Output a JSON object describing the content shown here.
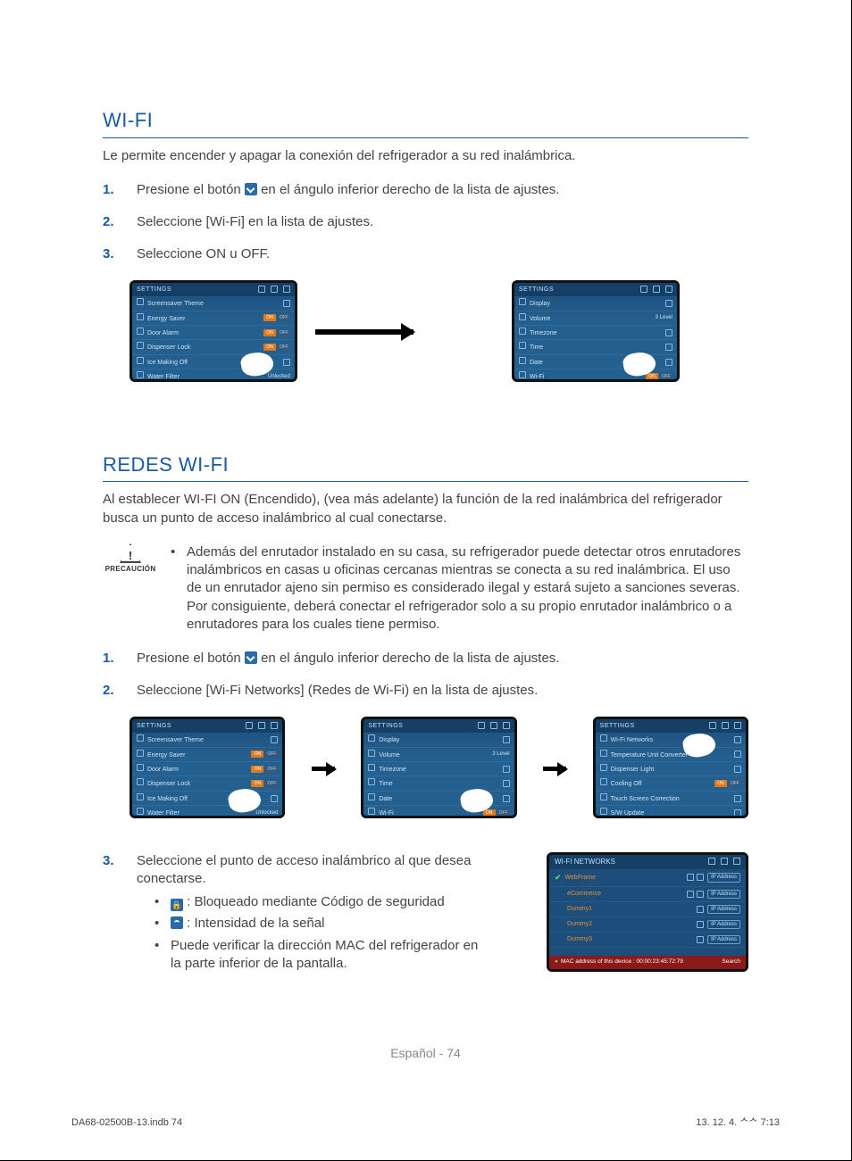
{
  "wifi": {
    "title": "WI-FI",
    "intro": "Le permite encender y apagar la conexión del refrigerador a su red inalámbrica.",
    "steps": [
      {
        "num": "1.",
        "before": "Presione el botón ",
        "after": " en el ángulo inferior derecho de la lista de ajustes."
      },
      {
        "num": "2.",
        "text": "Seleccione [Wi-Fi] en la lista de ajustes."
      },
      {
        "num": "3.",
        "text": "Seleccione ON u OFF."
      }
    ]
  },
  "redes": {
    "title": "REDES WI-FI",
    "intro": "Al establecer WI-FI ON (Encendido), (vea más adelante) la función de la red inalámbrica del refrigerador busca un punto de acceso inalámbrico al cual conectarse.",
    "caution_label": "PRECAUCIÓN",
    "caution_text": "Además del enrutador instalado en su casa, su refrigerador puede detectar otros enrutadores inalámbricos en casas u oficinas cercanas mientras se conecta a su red inalámbrica. El uso de un enrutador ajeno sin permiso es considerado ilegal y estará sujeto a sanciones severas. Por consiguiente, deberá conectar el refrigerador solo a su propio enrutador inalámbrico o a enrutadores para los cuales tiene permiso.",
    "steps": [
      {
        "num": "1.",
        "before": "Presione el botón ",
        "after": " en el ángulo inferior derecho de la lista de ajustes."
      },
      {
        "num": "2.",
        "text": "Seleccione [Wi-Fi Networks] (Redes de Wi-Fi) en la lista de ajustes."
      }
    ],
    "step3": {
      "num": "3.",
      "text": "Seleccione el punto de acceso inalámbrico al que desea conectarse.",
      "bullets": [
        {
          "icon": "lock",
          "txt": " : Bloqueado mediante Código de seguridad"
        },
        {
          "icon": "signal",
          "txt": " : Intensidad de la señal"
        },
        {
          "txt": "Puede verificar la dirección MAC del refrigerador en la parte inferior de la pantalla."
        }
      ]
    }
  },
  "screens": {
    "header_title": "SETTINGS",
    "settings1": [
      "Screensaver Theme",
      "Energy Saver",
      "Door Alarm",
      "Dispenser Lock",
      "Ice Making Off",
      "Water Filter"
    ],
    "settings2": [
      "Display",
      "Volume",
      "Timezone",
      "Time",
      "Date",
      "Wi-Fi"
    ],
    "settings3": [
      "Wi-Fi Networks",
      "Temperature Unit Converter",
      "Dispenser Light",
      "Cooling Off",
      "Touch Screen Correction",
      "S/W Update"
    ],
    "on": "ON",
    "off": "OFF",
    "unlocked": "Unlocked",
    "volume_level": "3 Level"
  },
  "net": {
    "title": "WI-FI NETWORKS",
    "rows": [
      {
        "name": "WebFrame",
        "checked": true,
        "locked": true
      },
      {
        "name": "eCommerce",
        "locked": true
      },
      {
        "name": "Dummy1"
      },
      {
        "name": "Dummy2"
      },
      {
        "name": "Dummy3"
      }
    ],
    "ip_btn": "IP Address",
    "mac_label": "MAC address of this device : 00:00:23:45:72:79",
    "search": "Search"
  },
  "footer": {
    "page": "Español - 74",
    "file": "DA68-02500B-13.indb   74",
    "timestamp": "13. 12. 4.   ᄉᄉ 7:13"
  }
}
